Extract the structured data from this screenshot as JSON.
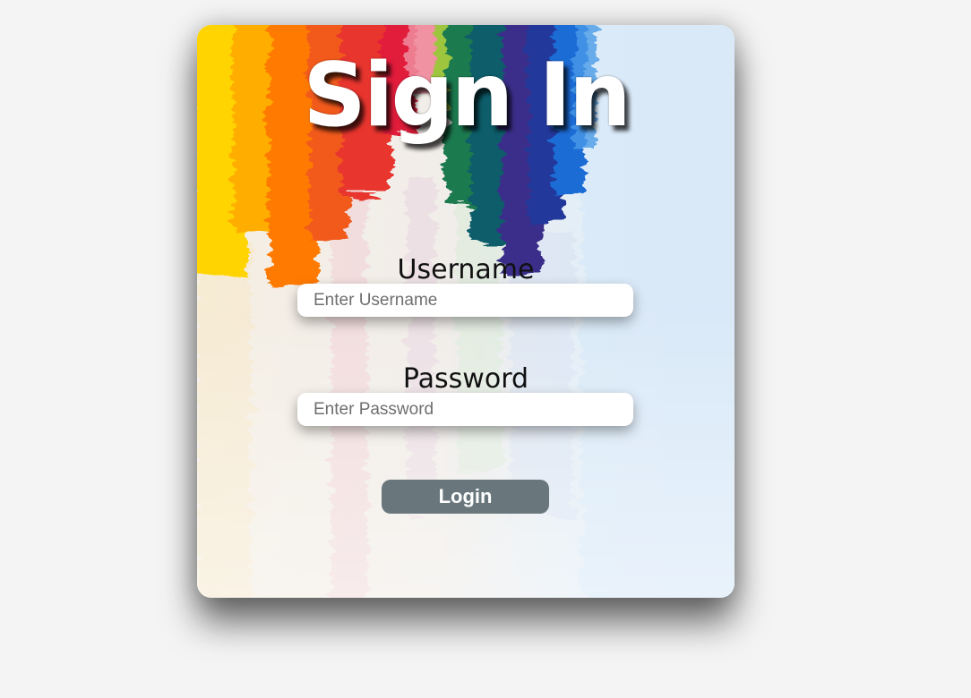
{
  "form": {
    "title": "Sign In",
    "username_label": "Username",
    "username_placeholder": "Enter Username",
    "password_label": "Password",
    "password_placeholder": "Enter Password",
    "login_label": "Login"
  },
  "colors": {
    "page_background": "#f4f4f4",
    "button_background": "#69777c",
    "title_text": "#ffffff",
    "label_text": "#111111"
  }
}
